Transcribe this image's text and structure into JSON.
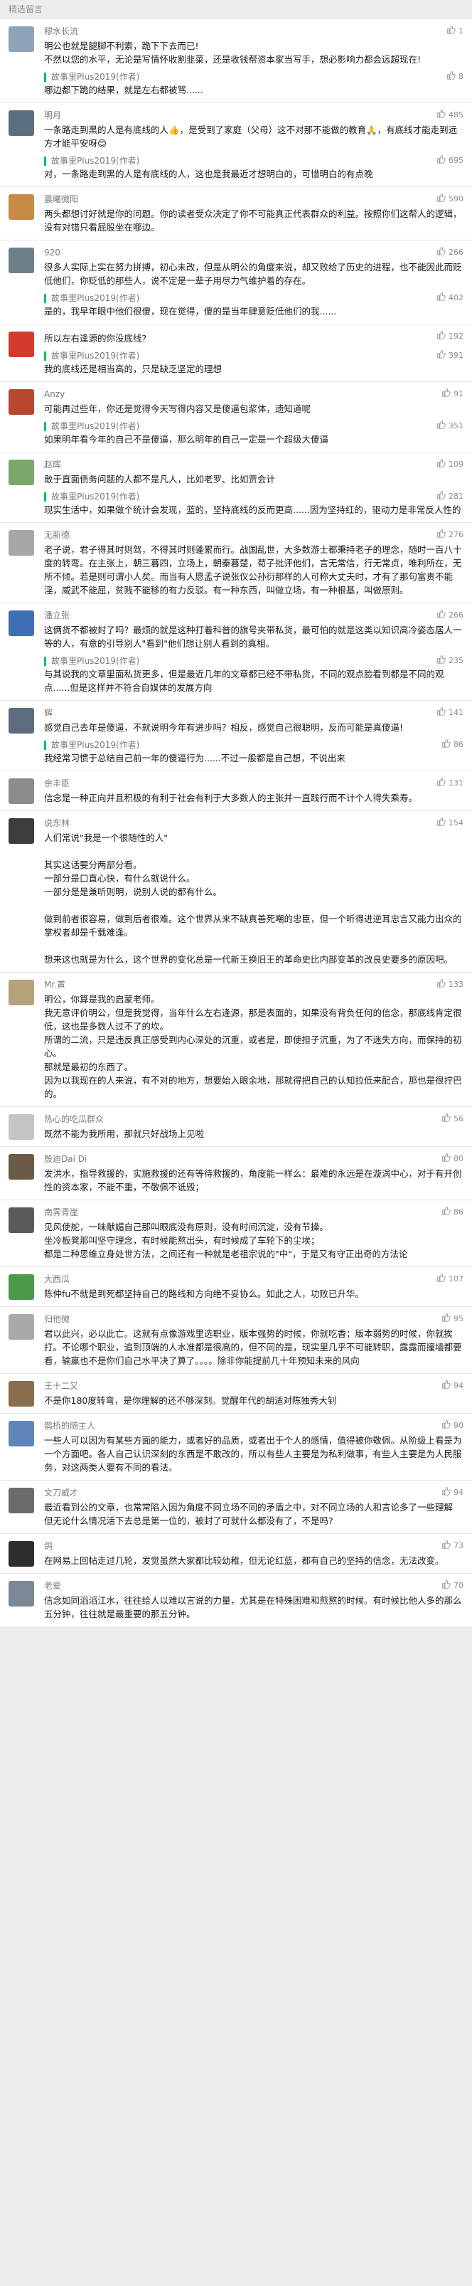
{
  "header": {
    "title": "精选留言"
  },
  "comments": [
    {
      "name": "穆水长流",
      "likes": "1",
      "avatar_color": "#8fa3b8",
      "text": "明公也就是腿脚不利索，跪下下去而已!\n不然以您的水平，无论是写情怀收割韭菜，还是收钱帮资本家当写手，想必影响力都会远超现在!",
      "reply": {
        "name": "故事里Plus2019(作者)",
        "likes": "8",
        "text": "哪边都下跪的结果，就是左右都被骂......"
      }
    },
    {
      "name": "明月",
      "likes": "485",
      "avatar_color": "#5b6f82",
      "text": "一条路走到黑的人是有底线的人👍，是受到了家庭（父母）这不对那不能做的教育🙏，有底线才能走到远方才能平安呀😊",
      "reply": {
        "name": "故事里Plus2019(作者)",
        "likes": "695",
        "text": "对，一条路走到黑的人是有底线的人，这也是我最近才想明白的，可惜明白的有点晚"
      }
    },
    {
      "name": "晨曦微阳",
      "likes": "590",
      "avatar_color": "#c98a48",
      "text": "两头都想讨好就是你的问题。你的读者受众决定了你不可能真正代表群众的利益。按照你们这帮人的逻辑，没有对错只看屁股坐在哪边。",
      "reply": null
    },
    {
      "name": "920",
      "likes": "266",
      "avatar_color": "#6e7f8a",
      "text": "很多人实际上实在努力拼搏，初心未改，但是从明公的角度来说，却又败给了历史的进程，也不能因此而贬低他们，你贬低的那些人，说不定是一辈子用尽力气维护着的存在。",
      "reply": {
        "name": "故事里Plus2019(作者)",
        "likes": "402",
        "text": "是的，我早年眼中他们很傻，现在觉得，傻的是当年肆意贬低他们的我......"
      }
    },
    {
      "name": "",
      "likes": "192",
      "avatar_color": "#d33a2c",
      "text": "所以左右逢源的你没底线?",
      "reply": {
        "name": "故事里Plus2019(作者)",
        "likes": "391",
        "text": "我的底线还是相当高的，只是缺乏坚定的理想"
      }
    },
    {
      "name": "Anzy",
      "likes": "91",
      "avatar_color": "#b8472e",
      "text": "可能再过些年，你还是觉得今天写得内容又是傻逼包浆体，遗知道呢",
      "reply": {
        "name": "故事里Plus2019(作者)",
        "likes": "351",
        "text": "如果明年看今年的自己不是傻逼，那么明年的自己一定是一个超级大傻逼"
      }
    },
    {
      "name": "赵晖",
      "likes": "109",
      "avatar_color": "#7aa86a",
      "text": "敢于直面债务问题的人都不是凡人，比如老罗、比如贾会计",
      "reply": {
        "name": "故事里Plus2019(作者)",
        "likes": "281",
        "text": "现实生活中，如果做个统计会发现，蓝的，坚持底线的反而更高......因为坚持红的，驱动力是非常反人性的"
      }
    },
    {
      "name": "无新德",
      "likes": "276",
      "avatar_color": "#a7a7a7",
      "text": "老子说，君子得其时则驾，不得其时则蓬累而行。战国乱世，大多数游士都秉持老子的理念，随时一百八十度的转弯。在主张上，朝三暮四，立场上，朝秦暮楚，荀子批评他们，言无常信，行无常贞，唯利所在，无所不倾。若是则可谓小人矣。而当有人愿孟子说张仪公孙衍那样的人可称大丈夫时，才有了那句富贵不能淫，威武不能屈，贫贱不能移的有力反驳。有一种东西，叫做立场，有一种根基，叫做原则。",
      "reply": null
    },
    {
      "name": "潘立张",
      "likes": "266",
      "avatar_color": "#3f6fb3",
      "text": "这俩货不都被封了吗？最烦的就是这种打着科普的旗号夹带私货，最可怕的就是这类以知识高冷姿态居人一等的人，有意的引导别人\"看到\"他们想让别人看到的真相。",
      "reply": {
        "name": "故事里Plus2019(作者)",
        "likes": "235",
        "text": "与其说我的文章里面私货更多，但是最近几年的文章都已经不带私货，不同的观点脸看到都是不同的观点......但是这样并不符合自媒体的发展方向"
      }
    },
    {
      "name": "辉",
      "likes": "141",
      "avatar_color": "#5a6c7d",
      "text": "感觉自己去年是傻逼，不就说明今年有进步吗？相反，感觉自己很聪明，反而可能是真傻逼!",
      "reply": {
        "name": "故事里Plus2019(作者)",
        "likes": "86",
        "text": "我经常习惯于总结自己前一年的傻逼行为......不过一般都是自己想，不说出来"
      }
    },
    {
      "name": "余丰臣",
      "likes": "131",
      "avatar_color": "#8c8c8c",
      "text": "信念是一种正向并且积极的有利于社会有利于大多数人的主张并一直践行而不计个人得失乘寿。",
      "reply": null
    },
    {
      "name": "说东林",
      "likes": "154",
      "avatar_color": "#3c3c3c",
      "text": "人们常说\"我是一个很随性的人\"\n\n其实这话要分两部分看。\n一部分是口直心快，有什么就说什么。\n一部分是是兼听则明，说别人说的都有什么。\n\n做到前者很容易，做到后者很难。这个世界从来不缺真善死嘲的忠臣，但一个听得进逆耳忠言又能力出众的掌权者却是千载难逢。\n\n想来这也就是为什么，这个世界的变化总是一代新王换旧王的革命史比内部变革的改良史要多的原因吧。",
      "reply": null
    },
    {
      "name": "Mr.黄",
      "likes": "133",
      "avatar_color": "#b3a27a",
      "text": "明公，你算是我的启蒙老师。\n我无意评价明公，但是我觉得，当年什么左右逢源，那是表面的，如果没有背负任何的信念，那底线肯定很低，这也是多数人过不了的坎。\n所谓的二流，只是违反真正感受到内心深处的沉重，或者是，即使担子沉重，为了不迷失方向，而保持的初心。\n那就是最初的东西了。\n因为以我现在的人来说，有不对的地方，想要始入眼余地，那就得把自己的认知拉低来配合，那也是很拧巴的。",
      "reply": null
    },
    {
      "name": "热心的吃瓜群众",
      "likes": "56",
      "avatar_color": "#c4c4c4",
      "text": "既然不能为我所用，那就只好战场上见啦",
      "reply": null
    },
    {
      "name": "殷迪Dai Di",
      "likes": "80",
      "avatar_color": "#6c5a48",
      "text": "发洪水，指导救援的，实施救援的还有等待救援的，角度能一样么：最难的永远是在漩涡中心，对于有开创性的资本家，不能不重，不敬佩不诋毁；",
      "reply": null
    },
    {
      "name": "南霁青崖",
      "likes": "86",
      "avatar_color": "#5b5b5b",
      "text": "见风使舵，一味献媚自己那叫眼底没有原则，没有时间沉淀，没有节操。\n坐冷板凳那叫坚守理念，有时候能熬出头，有时候成了车轮下的尘埃；\n都是二种思维立身处世方法，之间还有一种就是老祖宗说的\"中\"，于是又有守正出奇的方法论",
      "reply": null
    },
    {
      "name": "大西瓜",
      "likes": "107",
      "avatar_color": "#4a9a4a",
      "text": "陈仲fu不就是到死都坚持自己的路线和方向绝不妥协么。如此之人，功败已升华。",
      "reply": null
    },
    {
      "name": "归他微",
      "likes": "95",
      "avatar_color": "#a9a9a9",
      "text": "君以此兴，必以此亡。这就有点像游戏里选职业，版本强势的时候，你就吃香；版本弱势的时候，你就挨打。不论哪个职业，追到顶端的人水准都是很高的，但不同的是，现实里几乎不可能转职，露露而撞墙都要看，输赢也不是你们自己水平决了算了。。。。除非你能提前几十年预知未来的风向",
      "reply": null
    },
    {
      "name": "王十二又",
      "likes": "94",
      "avatar_color": "#8a6d4d",
      "text": "不是你180度转弯，是你理解的还不够深刻。觉醒年代的胡适对陈独秀大钊",
      "reply": null
    },
    {
      "name": "鹊桥的随主人",
      "likes": "90",
      "avatar_color": "#5e86b8",
      "text": "一些人可以因为有某些方面的能力，或者好的品质，或者出于个人的感情，值得被你敬佩。从阶级上看是为一个方面吧。各人自己认识深刻的东西是不敢改的，所以有些人主要是为私利做事，有些人主要是为人民服务，对这两类人要有不同的看法。",
      "reply": null
    },
    {
      "name": "文刀威才",
      "likes": "94",
      "avatar_color": "#6b6b6b",
      "text": "最近看到公的文章，也常常陷入因为角度不同立场不同的矛盾之中，对不同立场的人和言论多了一些理解\n但无论什么情况活下去总是第一位的，被封了可就什么都没有了，不是吗?",
      "reply": null
    },
    {
      "name": "鸽",
      "likes": "73",
      "avatar_color": "#2d2d2d",
      "text": "在网易上回帖走过几轮，发觉虽然大家都比较幼稚，但无论红蓝，都有自己的坚持的信念，无法改变。",
      "reply": null
    },
    {
      "name": "老爱",
      "likes": "70",
      "avatar_color": "#7b8896",
      "text": "信念如同滔滔江水，往往给人以难以言说的力量，尤其是在特殊困难和煎熬的时候。有时候比他人多的那么五分钟，往往就是最重要的那五分钟。",
      "reply": null
    }
  ]
}
